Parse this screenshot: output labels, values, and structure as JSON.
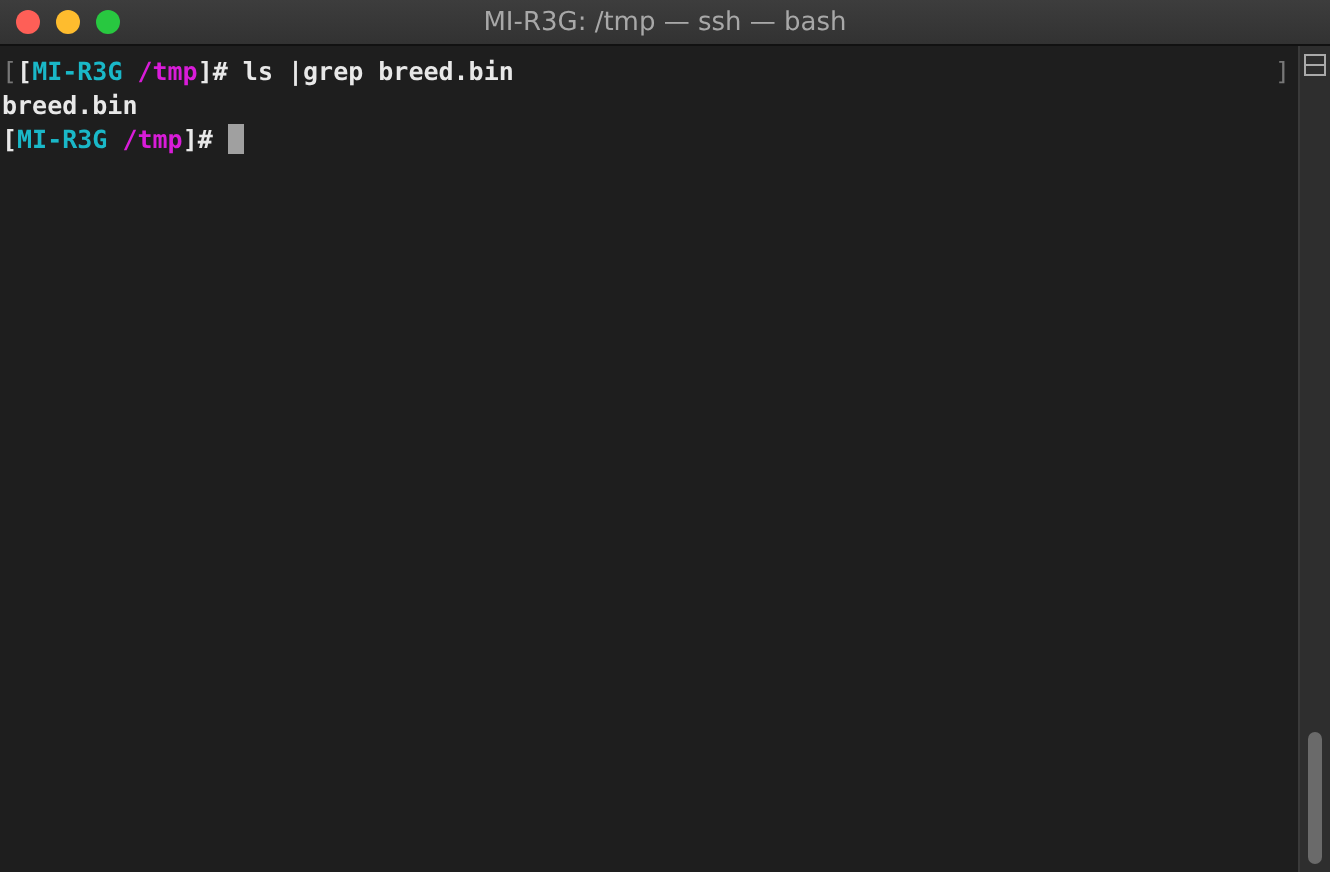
{
  "window": {
    "title": "MI-R3G: /tmp — ssh — bash"
  },
  "terminal": {
    "lines": [
      {
        "segments": [
          {
            "kind": "faint",
            "text": "["
          },
          {
            "kind": "plain",
            "text": "["
          },
          {
            "kind": "host",
            "text": "MI-R3G"
          },
          {
            "kind": "path",
            "text": "/tmp"
          },
          {
            "kind": "plain",
            "text": "]# ls |grep breed.bin"
          }
        ],
        "trailer": "]"
      },
      {
        "segments": [
          {
            "kind": "plain",
            "text": "breed.bin"
          }
        ]
      },
      {
        "segments": [
          {
            "kind": "plain",
            "text": "["
          },
          {
            "kind": "host",
            "text": "MI-R3G"
          },
          {
            "kind": "path",
            "text": "/tmp"
          },
          {
            "kind": "plain",
            "text": "]#"
          }
        ],
        "cursor": true
      }
    ]
  }
}
